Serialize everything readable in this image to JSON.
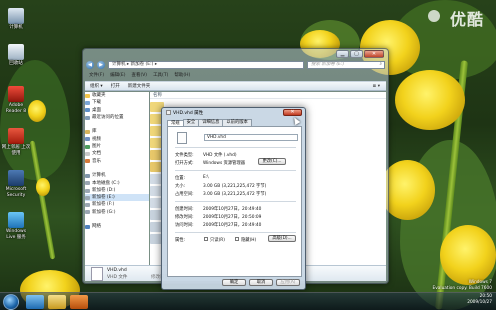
{
  "watermark": "优酷",
  "desktop_icons": [
    {
      "label": "计算机",
      "icon": "computer-icon"
    },
    {
      "label": "回收站",
      "icon": "recycle-bin-icon"
    },
    {
      "label": "Adobe Reader 8",
      "icon": "pdf-icon"
    },
    {
      "label": "网上邻居 上次使用",
      "icon": "network-icon"
    },
    {
      "label": "Microsoft Security",
      "icon": "security-icon"
    },
    {
      "label": "Windows Live 服务",
      "icon": "windows-live-icon"
    }
  ],
  "explorer": {
    "address": "计算机 ▸ 新加卷 (E:) ▸",
    "search_placeholder": "搜索 新加卷 (E:)",
    "menu": [
      "文件(F)",
      "编辑(E)",
      "查看(V)",
      "工具(T)",
      "帮助(H)"
    ],
    "toolbar": [
      "组织 ▾",
      "打开",
      "新建文件夹"
    ],
    "view_label": "≣ ▾",
    "nav": [
      {
        "label": "收藏夹",
        "icon": "star-icon",
        "selected": false
      },
      {
        "label": "下载",
        "icon": "download-folder-icon",
        "selected": false
      },
      {
        "label": "桌面",
        "icon": "desktop-folder-icon",
        "selected": false
      },
      {
        "label": "最近访问的位置",
        "icon": "recent-places-icon",
        "selected": false
      },
      {
        "label": "",
        "icon": "",
        "selected": false
      },
      {
        "label": "库",
        "icon": "library-icon",
        "selected": false
      },
      {
        "label": "视频",
        "icon": "video-library-icon",
        "selected": false
      },
      {
        "label": "图片",
        "icon": "pictures-library-icon",
        "selected": false
      },
      {
        "label": "文档",
        "icon": "documents-library-icon",
        "selected": false
      },
      {
        "label": "音乐",
        "icon": "music-library-icon",
        "selected": false
      },
      {
        "label": "",
        "icon": "",
        "selected": false
      },
      {
        "label": "计算机",
        "icon": "computer-icon",
        "selected": false
      },
      {
        "label": "本地磁盘 (C:)",
        "icon": "drive-icon",
        "selected": false
      },
      {
        "label": "新加卷 (D:)",
        "icon": "drive-icon",
        "selected": false
      },
      {
        "label": "新加卷 (E:)",
        "icon": "drive-icon",
        "selected": true
      },
      {
        "label": "新加卷 (F:)",
        "icon": "drive-icon",
        "selected": false
      },
      {
        "label": "新加卷 (G:)",
        "icon": "drive-icon",
        "selected": false
      },
      {
        "label": "",
        "icon": "",
        "selected": false
      },
      {
        "label": "网络",
        "icon": "network-icon",
        "selected": false
      }
    ],
    "column_header": "名称",
    "details": {
      "name": "VHD.vhd",
      "type": "VHD 文件",
      "modified": "修改日期:"
    }
  },
  "dialog": {
    "title": "VHD.vhd 属性",
    "close": "✕",
    "tabs": [
      "常规",
      "安全",
      "详细信息",
      "以前的版本"
    ],
    "active_tab": 0,
    "file_name": "VHD.vhd",
    "rows": [
      {
        "label": "文件类型:",
        "value": "VHD 文件 (.vhd)"
      },
      {
        "label": "打开方式:",
        "value": "Windows 资源管理器"
      },
      {
        "label": "位置:",
        "value": "E:\\"
      },
      {
        "label": "大小:",
        "value": "3.00 GB (3,221,225,472 字节)"
      },
      {
        "label": "占用空间:",
        "value": "3.00 GB (3,221,225,472 字节)"
      },
      {
        "label": "创建时间:",
        "value": "2009年10月27日，20:49:40"
      },
      {
        "label": "修改时间:",
        "value": "2009年10月27日，20:50:09"
      },
      {
        "label": "访问时间:",
        "value": "2009年10月27日，20:49:40"
      },
      {
        "label": "属性:",
        "value": ""
      }
    ],
    "change_button": "更改(C)...",
    "readonly_label": "只读(R)",
    "hidden_label": "隐藏(H)",
    "advanced_button": "高级(D)...",
    "ok": "确定",
    "cancel": "取消",
    "apply": "应用(A)"
  },
  "win7_note": [
    "Windows 7",
    "Evaluation copy. Build 7600"
  ],
  "tray": {
    "time": "20:50",
    "date": "2009/10/27"
  }
}
